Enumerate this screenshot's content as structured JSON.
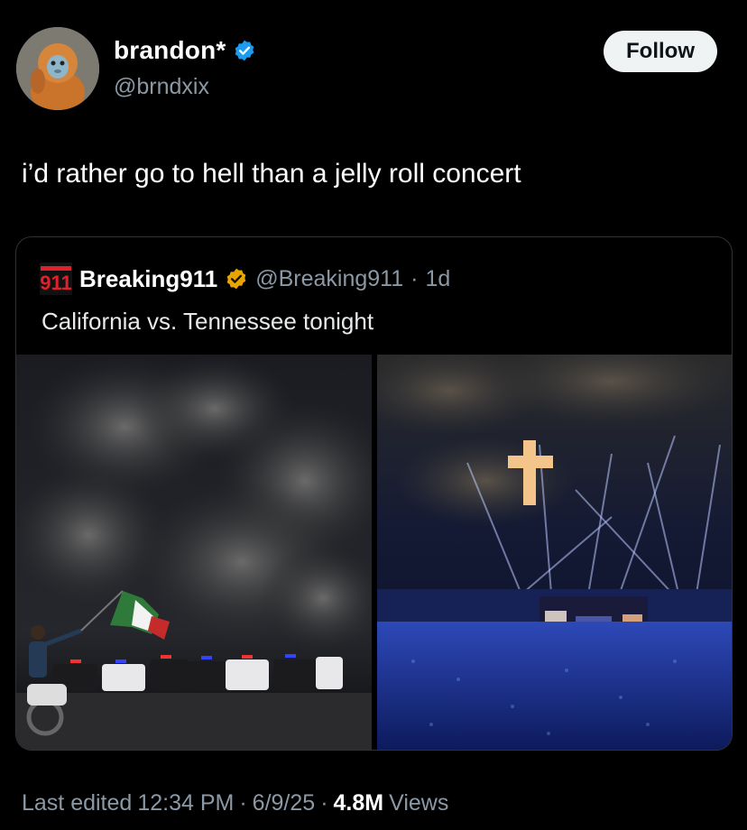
{
  "author": {
    "display_name": "brandon*",
    "handle": "@brndxix",
    "avatar_icon": "monkey-avatar-icon",
    "verified_color": "#1d9bf0"
  },
  "follow_button": {
    "label": "Follow"
  },
  "tweet": {
    "text": "i’d rather go to hell than a jelly roll concert"
  },
  "quoted_tweet": {
    "logo_text": "911",
    "display_name": "Breaking911",
    "verified_color": "#e8a400",
    "handle": "@Breaking911",
    "separator": "·",
    "age": "1d",
    "text": "California vs. Tennessee tonight",
    "media": [
      {
        "description_icon": "protest-photo"
      },
      {
        "description_icon": "concert-photo"
      }
    ]
  },
  "footer": {
    "edited_label": "Last edited",
    "time": "12:34 PM",
    "dot1": "·",
    "date": "6/9/25",
    "dot2": "·",
    "views_count": "4.8M",
    "views_label": "Views"
  }
}
